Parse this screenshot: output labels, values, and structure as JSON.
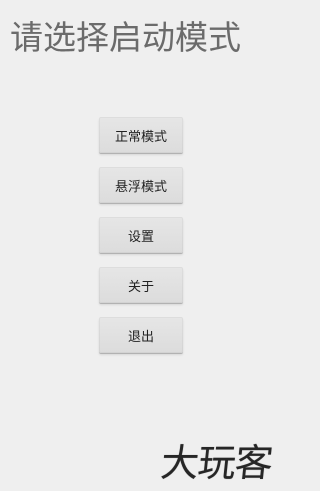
{
  "title": "请选择启动模式",
  "menu": {
    "items": [
      {
        "label": "正常模式"
      },
      {
        "label": "悬浮模式"
      },
      {
        "label": "设置"
      },
      {
        "label": "关于"
      },
      {
        "label": "退出"
      }
    ]
  },
  "watermark": {
    "text": "大玩客"
  }
}
